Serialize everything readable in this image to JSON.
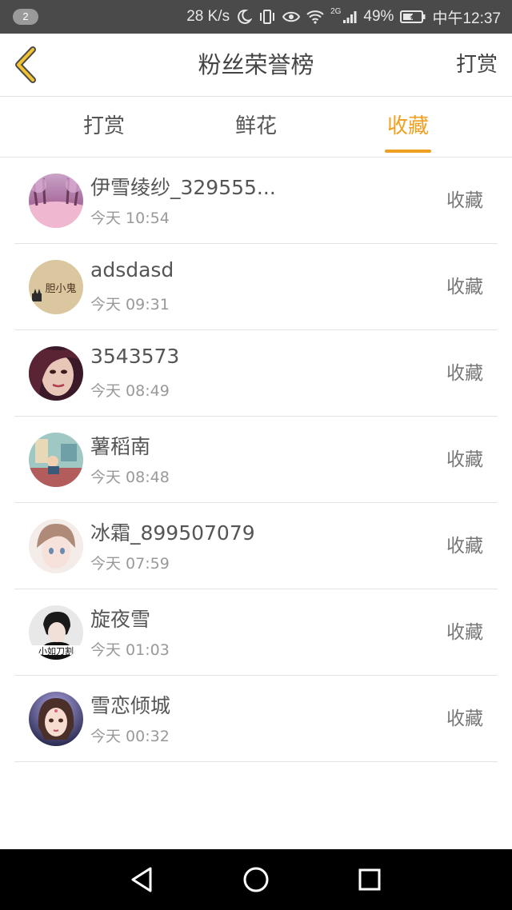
{
  "status_bar": {
    "notification_count": "2",
    "network_speed": "28 K/s",
    "signal_type": "2G",
    "battery": "49%",
    "time": "中午12:37"
  },
  "header": {
    "title": "粉丝荣誉榜",
    "right_action": "打赏"
  },
  "tabs": [
    {
      "label": "打赏",
      "active": false
    },
    {
      "label": "鲜花",
      "active": false
    },
    {
      "label": "收藏",
      "active": true
    }
  ],
  "list": [
    {
      "name": "伊雪绫纱_329555...",
      "time": "今天 10:54",
      "action": "收藏"
    },
    {
      "name": "adsdasd",
      "time": "今天 09:31",
      "action": "收藏"
    },
    {
      "name": "3543573",
      "time": "今天 08:49",
      "action": "收藏"
    },
    {
      "name": "薯稻南",
      "time": "今天 08:48",
      "action": "收藏"
    },
    {
      "name": "冰霜_899507079",
      "time": "今天 07:59",
      "action": "收藏"
    },
    {
      "name": "旋夜雪",
      "time": "今天 01:03",
      "action": "收藏"
    },
    {
      "name": "雪恋倾城",
      "time": "今天 00:32",
      "action": "收藏"
    }
  ],
  "avatar_texts": {
    "avatar_2": "胆小鬼",
    "avatar_6": "小如刀割"
  },
  "colors": {
    "accent": "#f0a020",
    "status_bar": "#4a4a4a",
    "nav_bar": "#000000"
  },
  "icons": {
    "back": "chevron-left-icon",
    "nav_back": "triangle-back-icon",
    "nav_home": "circle-home-icon",
    "nav_recents": "square-recents-icon"
  }
}
